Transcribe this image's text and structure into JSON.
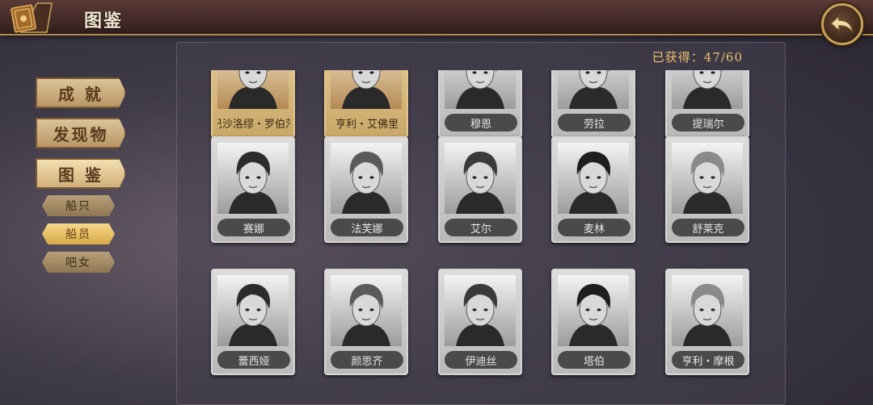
{
  "header": {
    "title": "图鉴",
    "back_icon": "back-arrow-icon",
    "book_icon": "codex-book-icon"
  },
  "nav": {
    "main": [
      {
        "label": "成 就",
        "active": false
      },
      {
        "label": "发现物",
        "active": false
      },
      {
        "label": "图 鉴",
        "active": true
      }
    ],
    "sub": [
      {
        "label": "船只",
        "active": false
      },
      {
        "label": "船员",
        "active": true
      },
      {
        "label": "吧女",
        "active": false
      }
    ]
  },
  "panel": {
    "counter": "已获得：47/60",
    "rows": [
      {
        "cards": [
          {
            "name": "巴沙洛缪・罗伯茨",
            "style": "gold"
          },
          {
            "name": "亨利・艾佛里",
            "style": "gold"
          },
          {
            "name": "穆恩",
            "style": "gray"
          },
          {
            "name": "劳拉",
            "style": "gray"
          },
          {
            "name": "提瑞尔",
            "style": "gray"
          }
        ]
      },
      {
        "cards": [
          {
            "name": "赛娜",
            "style": "gray"
          },
          {
            "name": "法芙娜",
            "style": "gray"
          },
          {
            "name": "艾尔",
            "style": "gray"
          },
          {
            "name": "麦林",
            "style": "gray"
          },
          {
            "name": "舒莱克",
            "style": "gray"
          }
        ]
      },
      {
        "cards": [
          {
            "name": "蕾西娅",
            "style": "gray"
          },
          {
            "name": "颜思齐",
            "style": "gray"
          },
          {
            "name": "伊迪丝",
            "style": "gray"
          },
          {
            "name": "塔伯",
            "style": "gray"
          },
          {
            "name": "亨利・摩根",
            "style": "gray"
          }
        ]
      }
    ]
  },
  "colors": {
    "accent_gold": "#ecc070",
    "header_bg": "#3e2724"
  }
}
